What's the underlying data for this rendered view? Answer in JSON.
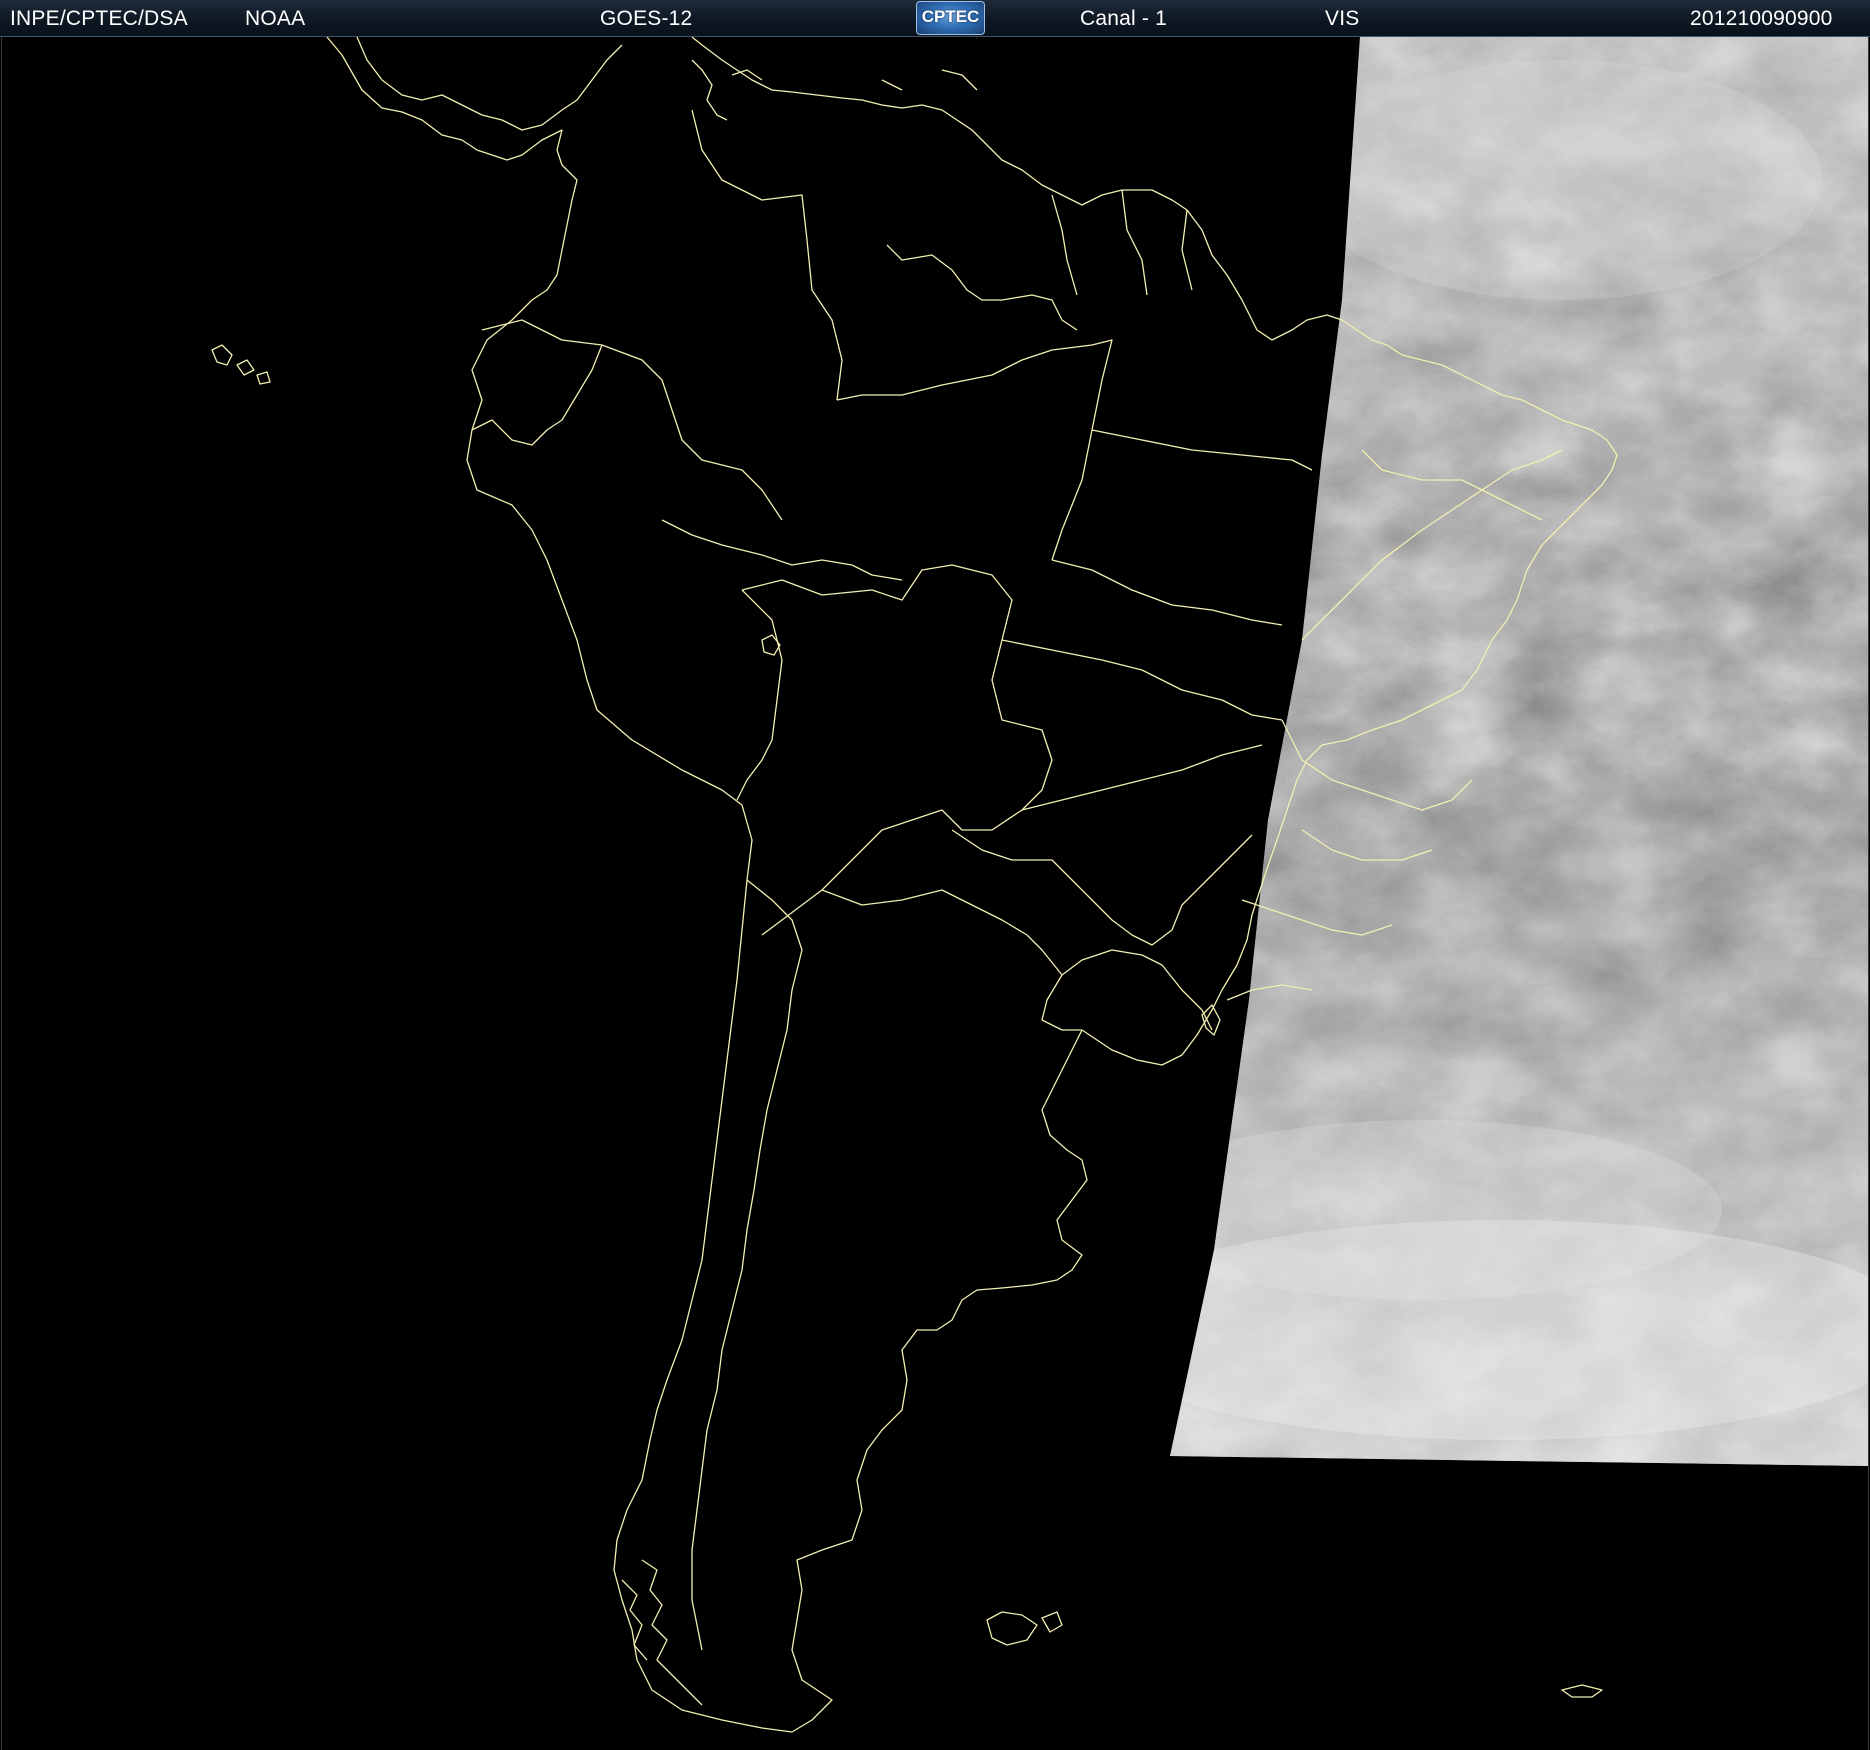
{
  "header": {
    "agency": "INPE/CPTEC/DSA",
    "source": "NOAA",
    "satellite": "GOES-12",
    "logo_text": "CPTEC",
    "channel": "Canal - 1",
    "band": "VIS",
    "timestamp": "201210090900"
  },
  "colors": {
    "background": "#000000",
    "header_background": "#0d1722",
    "header_text": "#ffffff",
    "boundary_lines": "#f2efb0",
    "logo_blue": "#2f6fb5"
  },
  "map": {
    "region": "South America",
    "imagery": "visible-channel satellite cloud imagery (grayscale)",
    "icons": [
      "cptec-logo"
    ]
  }
}
